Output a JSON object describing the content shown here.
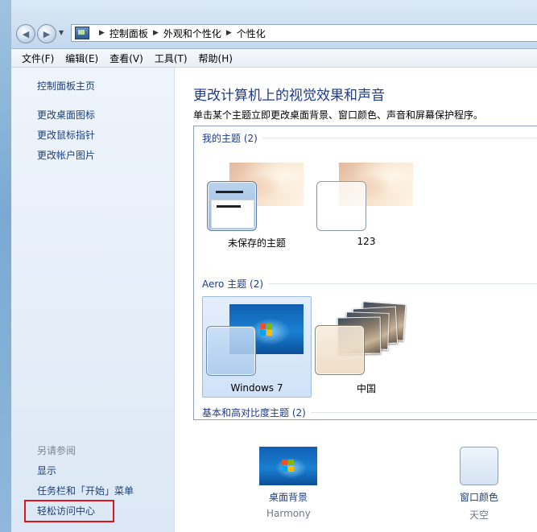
{
  "address_bar": {
    "crumbs": [
      "控制面板",
      "外观和个性化",
      "个性化"
    ]
  },
  "menu": [
    "文件(F)",
    "编辑(E)",
    "查看(V)",
    "工具(T)",
    "帮助(H)"
  ],
  "left_pane": {
    "home_link": "控制面板主页",
    "links": [
      "更改桌面图标",
      "更改鼠标指针",
      "更改帐户图片"
    ],
    "see_also_heading": "另请参阅",
    "see_also_links": [
      "显示",
      "任务栏和「开始」菜单",
      "轻松访问中心"
    ]
  },
  "main": {
    "title": "更改计算机上的视觉效果和声音",
    "description": "单击某个主题立即更改桌面背景、窗口颜色、声音和屏幕保护程序。",
    "groups": {
      "my_themes": {
        "label": "我的主题 (2)",
        "items": [
          {
            "name": "未保存的主题"
          },
          {
            "name": "123"
          }
        ]
      },
      "aero_themes": {
        "label": "Aero 主题 (2)",
        "items": [
          {
            "name": "Windows 7",
            "selected": true
          },
          {
            "name": "中国"
          }
        ]
      },
      "basic_themes": {
        "label": "基本和高对比度主题 (2)"
      }
    },
    "options": {
      "desktop_background": {
        "label": "桌面背景",
        "value": "Harmony"
      },
      "window_color": {
        "label": "窗口颜色",
        "value": "天空"
      }
    }
  },
  "colors": {
    "link_blue": "#1c3f7a",
    "title_blue": "#1e3a8a",
    "highlight_red": "#e0141a"
  }
}
